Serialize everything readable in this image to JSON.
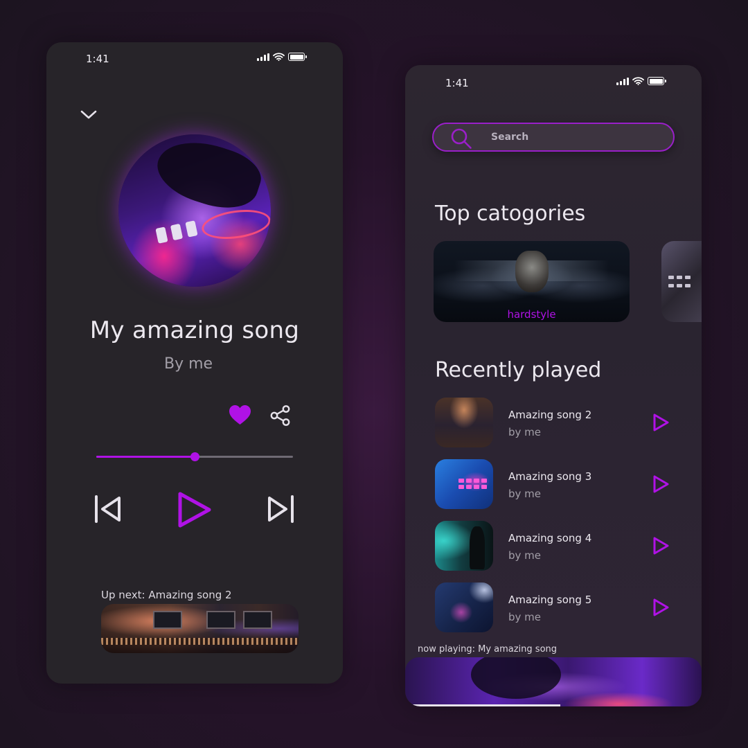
{
  "player": {
    "status_time": "1:41",
    "song_title": "My amazing song",
    "song_artist": "By me",
    "progress": 0.5,
    "up_next_label": "Up next: Amazing song 2",
    "colors": {
      "accent": "#b012e6",
      "background": "#272429"
    },
    "icons": [
      "chevron-down-icon",
      "heart-icon",
      "share-icon",
      "skip-previous-icon",
      "play-icon",
      "skip-next-icon"
    ]
  },
  "browse": {
    "status_time": "1:41",
    "search_placeholder": "Search",
    "top_categories_title": "Top catogories",
    "categories": [
      {
        "label": "hardstyle"
      },
      {
        "label": ""
      }
    ],
    "recently_played_title": "Recently played",
    "recent": [
      {
        "title": "Amazing song 2",
        "artist": "by me"
      },
      {
        "title": "Amazing song 3",
        "artist": "by me"
      },
      {
        "title": "Amazing song 4",
        "artist": "by me"
      },
      {
        "title": "Amazing song 5",
        "artist": "by me"
      }
    ],
    "now_playing_label": "now playing: My amazing song",
    "now_playing_progress": 0.5
  }
}
